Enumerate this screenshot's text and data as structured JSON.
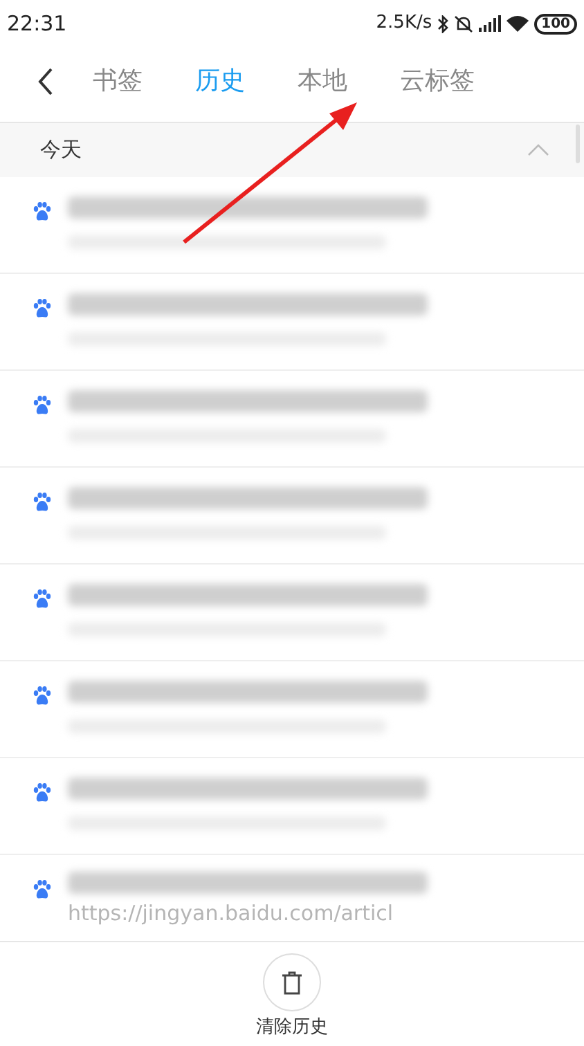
{
  "status_bar": {
    "time": "22:31",
    "speed": "2.5K/s",
    "battery": "100"
  },
  "tabs": [
    {
      "label": "书签",
      "selected": false
    },
    {
      "label": "历史",
      "selected": true
    },
    {
      "label": "本地",
      "selected": false
    },
    {
      "label": "云标签",
      "selected": false
    }
  ],
  "section": {
    "title": "今天",
    "expanded": true
  },
  "items": [
    {
      "kind": "blurred"
    },
    {
      "kind": "blurred"
    },
    {
      "kind": "blurred"
    },
    {
      "kind": "blurred"
    },
    {
      "kind": "blurred"
    },
    {
      "kind": "blurred"
    },
    {
      "kind": "blurred"
    },
    {
      "kind": "partial",
      "url": "https://jingyan.baidu.com/articl"
    }
  ],
  "bottom_bar": {
    "clear_label": "清除历史"
  },
  "annotation": {
    "kind": "arrow"
  }
}
